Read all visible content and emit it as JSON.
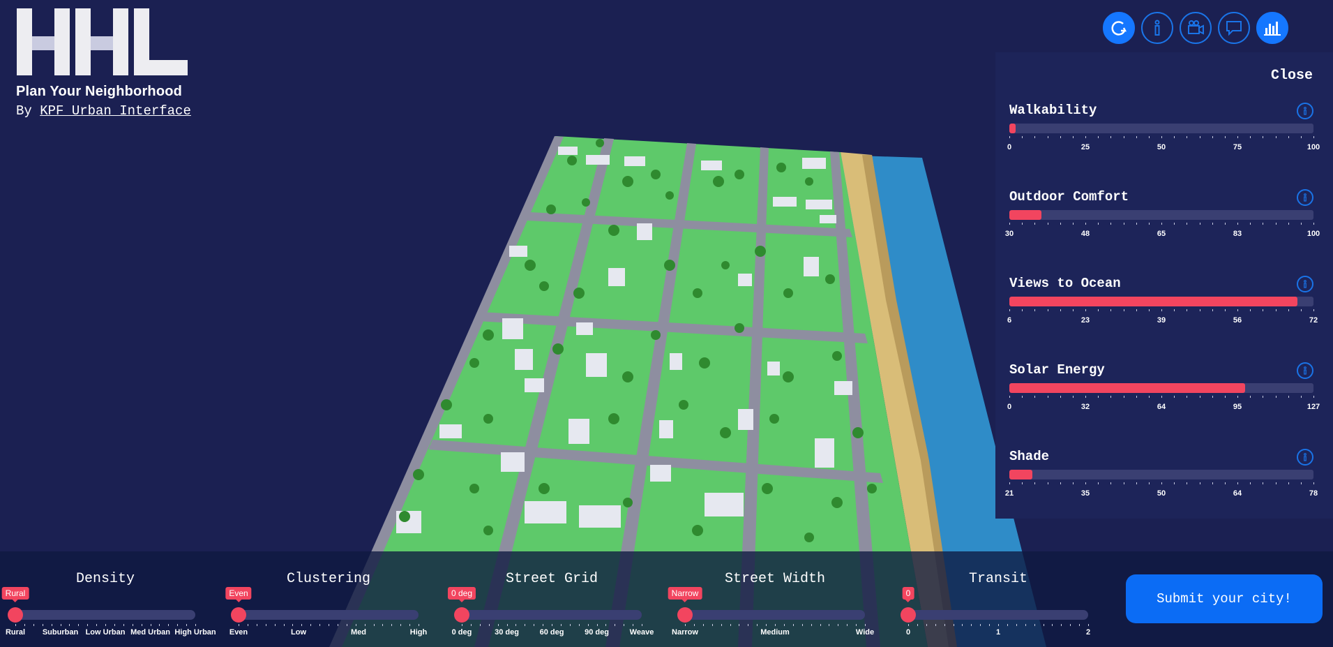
{
  "brand": {
    "title": "Plan Your Neighborhood",
    "by_prefix": "By",
    "by_link": "KPF Urban Interface",
    "logo_text": "HHL"
  },
  "top_icons": [
    {
      "name": "reset-icon",
      "active": true
    },
    {
      "name": "info-icon",
      "active": false
    },
    {
      "name": "camera-icon",
      "active": false
    },
    {
      "name": "comment-icon",
      "active": false
    },
    {
      "name": "bar-chart-icon",
      "active": true
    }
  ],
  "panel": {
    "close_label": "Close",
    "metrics": [
      {
        "title": "Walkability",
        "fill": 0.02,
        "labels": [
          "0",
          "25",
          "50",
          "75",
          "100"
        ]
      },
      {
        "title": "Outdoor Comfort",
        "fill": 0.105,
        "labels": [
          "30",
          "48",
          "65",
          "83",
          "100"
        ]
      },
      {
        "title": "Views to Ocean",
        "fill": 0.947,
        "labels": [
          "6",
          "23",
          "39",
          "56",
          "72"
        ]
      },
      {
        "title": "Solar Energy",
        "fill": 0.775,
        "labels": [
          "0",
          "32",
          "64",
          "95",
          "127"
        ]
      },
      {
        "title": "Shade",
        "fill": 0.075,
        "labels": [
          "21",
          "35",
          "50",
          "64",
          "78"
        ]
      }
    ]
  },
  "controls": [
    {
      "title": "Density",
      "badge": "Rural",
      "value_index": 0,
      "labels": [
        "Rural",
        "Suburban",
        "Low Urban",
        "Med Urban",
        "High Urban"
      ]
    },
    {
      "title": "Clustering",
      "badge": "Even",
      "value_index": 0,
      "labels": [
        "Even",
        "Low",
        "Med",
        "High"
      ]
    },
    {
      "title": "Street Grid",
      "badge": "0 deg",
      "value_index": 0,
      "labels": [
        "0 deg",
        "30 deg",
        "60 deg",
        "90 deg",
        "Weave"
      ]
    },
    {
      "title": "Street Width",
      "badge": "Narrow",
      "value_index": 0,
      "labels": [
        "Narrow",
        "Medium",
        "Wide"
      ]
    },
    {
      "title": "Transit",
      "badge": "0",
      "value_index": 0,
      "labels": [
        "0",
        "1",
        "2"
      ]
    }
  ],
  "submit_label": "Submit your city!",
  "colors": {
    "background": "#1b2052",
    "accent_red": "#f2455f",
    "accent_blue": "#0b6cf5",
    "grass": "#5ec96a",
    "ocean": "#2f8cc8",
    "sand": "#d9bd78"
  }
}
